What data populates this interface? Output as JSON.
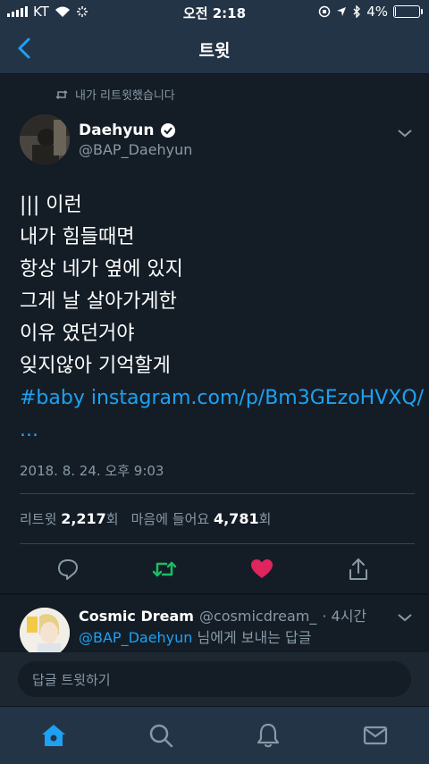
{
  "colors": {
    "accent": "#1da1f2",
    "retweet": "#17bf63",
    "like": "#e0245e",
    "muted": "#8899a6",
    "bg": "#141d26",
    "bar": "#243447"
  },
  "status": {
    "carrier": "KT",
    "time": "오전 2:18",
    "battery": "4%",
    "battery_level": 0.04
  },
  "nav": {
    "title": "트윗",
    "back_icon": "chevron-left-icon"
  },
  "tweet": {
    "retweeted_by": "내가 리트윗했습니다",
    "author_name": "Daehyun",
    "author_handle": "@BAP_Daehyun",
    "lines": [
      "|||",
      "이런",
      "내가 힘들때면",
      "항상 네가 옆에 있지",
      "그게 날 살아가게한",
      "이유 였던거야",
      "잊지않아 기억할게"
    ],
    "hashtag": "#baby",
    "link": "instagram.com/p/Bm3GEzoHVXQ/",
    "ellipsis": "...",
    "timestamp": "2018. 8. 24. 오후 9:03",
    "retweets_label": "리트윗",
    "retweets_count": "2,217",
    "likes_label": "마음에 들어요",
    "likes_count": "4,781",
    "count_suffix": "회"
  },
  "reply": {
    "name": "Cosmic Dream",
    "handle": "@cosmicdream_",
    "time": "· 4시간",
    "to_handle": "@BAP_Daehyun",
    "to_suffix": "님에게 보내는 답글"
  },
  "composer": {
    "placeholder": "답글 트윗하기"
  }
}
